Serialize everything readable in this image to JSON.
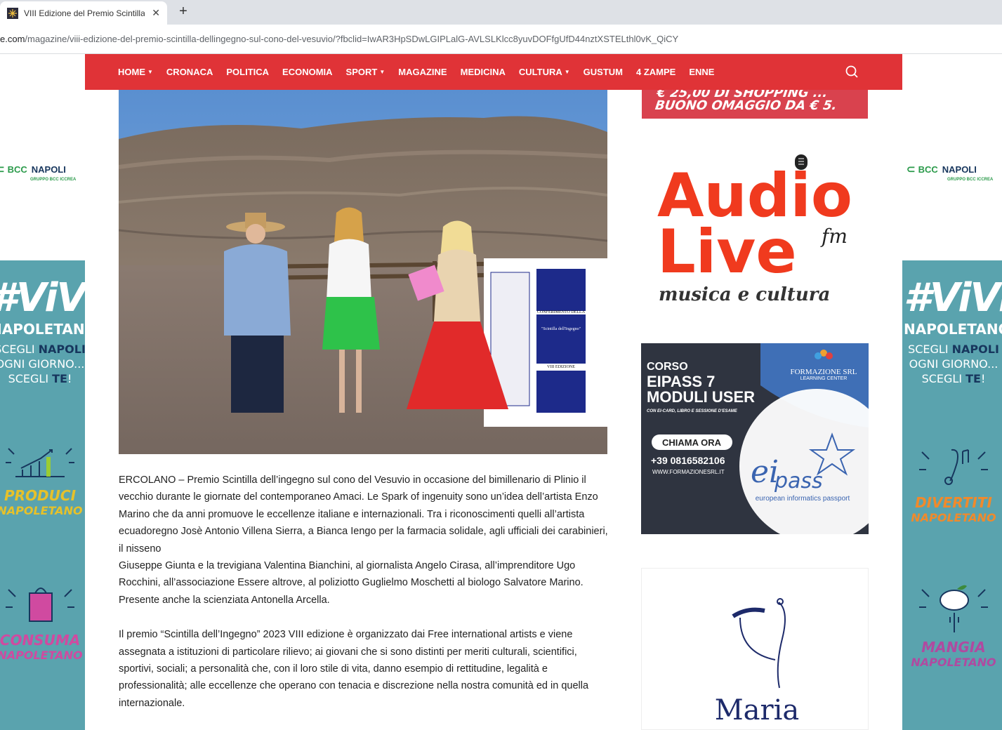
{
  "browser": {
    "tab_title": "VIII Edizione del Premio Scintilla",
    "tab_close": "✕",
    "new_tab": "+",
    "url_prefix": "e.com",
    "url_path": "/magazine/viii-edizione-del-premio-scintilla-dellingegno-sul-cono-del-vesuvio/?fbclid=IwAR3HpSDwLGIPLalG-AVLSLKlcc8yuvDOFfgUfD44nztXSTELthl0vK_QiCY"
  },
  "nav": {
    "items": [
      {
        "label": "HOME",
        "dropdown": true
      },
      {
        "label": "CRONACA",
        "dropdown": false
      },
      {
        "label": "POLITICA",
        "dropdown": false
      },
      {
        "label": "ECONOMIA",
        "dropdown": false
      },
      {
        "label": "SPORT",
        "dropdown": true
      },
      {
        "label": "MAGAZINE",
        "dropdown": false
      },
      {
        "label": "MEDICINA",
        "dropdown": false
      },
      {
        "label": "CULTURA",
        "dropdown": true
      },
      {
        "label": "GUSTUM",
        "dropdown": false
      },
      {
        "label": "4 ZAMPE",
        "dropdown": false
      },
      {
        "label": "ENNE",
        "dropdown": false
      }
    ],
    "search_icon": "search-icon",
    "color": "#e03337"
  },
  "article": {
    "paragraphs": [
      "ERCOLANO – Premio Scintilla dell’ingegno sul cono del Vesuvio in occasione del bimillenario di Plinio il vecchio durante le giornate del contemporaneo Amaci. Le Spark of ingenuity sono un’idea dell’artista Enzo Marino che da anni promuove le eccellenze italiane e internazionali. Tra i riconoscimenti quelli all’artista ecuadoregno Josè Antonio Villena Sierra, a Bianca Iengo per la farmacia solidale, agli ufficiali dei carabinieri, il nisseno",
      "Giuseppe Giunta e la trevigiana Valentina Bianchini, al giornalista Angelo Cirasa, all’imprenditore Ugo Rocchini, all’associazione Essere altrove, al poliziotto Guglielmo Moschetti al biologo Salvatore Marino. Presente anche la scienziata Antonella Arcella.",
      "Il premio “Scintilla dell’Ingegno” 2023 VIII edizione è organizzato dai Free international artists e viene assegnata a istituzioni di particolare rilievo; ai giovani che si sono distinti per meriti culturali, scientifici, sportivi, sociali; a personalità che, con il loro stile di vita, danno esempio di rettitudine, legalità e professionalità; alle eccellenze che operano con tenacia e discrezione nella nostra comunità ed in quella internazionale."
    ]
  },
  "photo_banner": {
    "line1": "CONFERIMENTO DELLA",
    "line2": "\"Scintilla dell'Ingegno\"",
    "line3": "VIII EDIZIONE"
  },
  "side_ads": {
    "bcc_b1": "BCC",
    "bcc_b2": "NAPOLI",
    "bcc_sub": "GRUPPO BCC ICCREA",
    "vivi_hash": "#ViVi",
    "vivi_nap": "NAPOLETANO",
    "vivi_tag1_pre": "SCEGLI ",
    "vivi_tag1_bold": "NAPOLI",
    "vivi_tag2": "OGNI GIORNO...",
    "vivi_tag3_pre": "SCEGLI ",
    "vivi_tag3_bold": "TE",
    "vivi_tag3_post": "!",
    "produci": "PRODUCI",
    "consuma": "CONSUMA",
    "divertiti": "DIVERTITI",
    "mangia": "MANGIA",
    "napoletano": "NAPOLETANO"
  },
  "sidebar": {
    "promo_line1": "€ 25,00 DI SHOPPING ...",
    "promo_line2": "BUONO OMAGGIO DA € 5.",
    "audio_title1": "Audio",
    "audio_title2": "Live",
    "audio_fm": "fm",
    "audio_tag": "musica e cultura",
    "eipass_corso": "CORSO",
    "eipass_title1": "EIPASS 7",
    "eipass_title2": "MODULI USER",
    "eipass_sub": "CON EI-CARD, LIBRO E SESSIONE D'ESAME",
    "eipass_brand1": "FORMAZIONE SRL",
    "eipass_brand2": "LEARNING CENTER",
    "eipass_cta": "CHIAMA ORA",
    "eipass_phone": "+39 0816582106",
    "eipass_site": "WWW.FORMAZIONESRL.IT",
    "eipass_logo_ei": "ei",
    "eipass_logo_pass": "pass",
    "eipass_logo_sub": "european informatics passport",
    "maria_name": "Maria"
  }
}
